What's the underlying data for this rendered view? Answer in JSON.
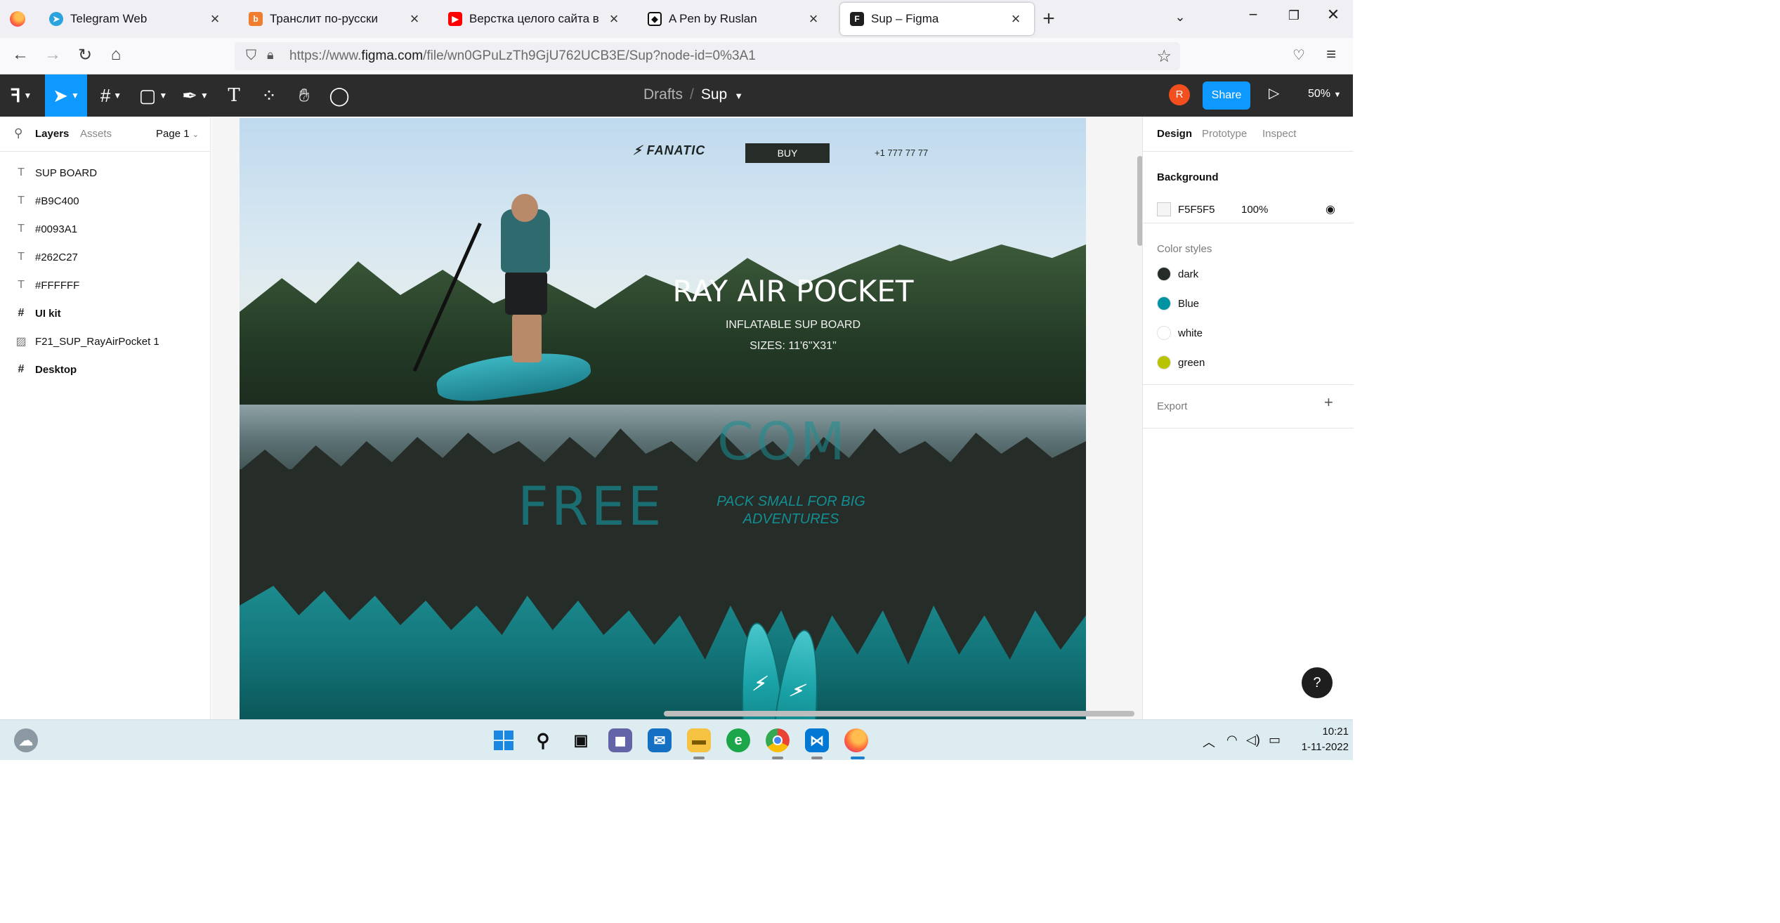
{
  "browser": {
    "tabs": [
      {
        "title": "Telegram Web",
        "favicon": "telegram-icon",
        "color": "#2aa3df"
      },
      {
        "title": "Транслит по-русски",
        "favicon": "translit-icon",
        "color": "#f07c2e"
      },
      {
        "title": "Верстка целого сайта в одном",
        "favicon": "youtube-icon",
        "color": "#ff0000"
      },
      {
        "title": "A Pen by Ruslan",
        "favicon": "codepen-icon",
        "color": "#111111"
      },
      {
        "title": "Sup – Figma",
        "favicon": "figma-icon",
        "color": "#1e1e1e",
        "active": true
      }
    ],
    "url_prefix": "https://www.",
    "url_domain": "figma.com",
    "url_path": "/file/wn0GPuLzTh9GjU762UCB3E/Sup?node-id=0%3A1"
  },
  "figma": {
    "breadcrumb_drafts": "Drafts",
    "breadcrumb_sep": "/",
    "file_name": "Sup",
    "avatar_initial": "R",
    "share_label": "Share",
    "zoom": "50%",
    "left_tabs": {
      "layers": "Layers",
      "assets": "Assets",
      "page": "Page 1"
    },
    "layers": [
      {
        "name": "SUP BOARD",
        "icon": "text-icon",
        "glyph": "T",
        "frame": false
      },
      {
        "name": "#B9C400",
        "icon": "text-icon",
        "glyph": "T",
        "frame": false
      },
      {
        "name": "#0093A1",
        "icon": "text-icon",
        "glyph": "T",
        "frame": false
      },
      {
        "name": "#262C27",
        "icon": "text-icon",
        "glyph": "T",
        "frame": false
      },
      {
        "name": "#FFFFFF",
        "icon": "text-icon",
        "glyph": "T",
        "frame": false
      },
      {
        "name": "UI kit",
        "icon": "frame-icon",
        "glyph": "#",
        "frame": true
      },
      {
        "name": "F21_SUP_RayAirPocket 1",
        "icon": "image-icon",
        "glyph": "▨",
        "frame": false
      },
      {
        "name": "Desktop",
        "icon": "frame-icon",
        "glyph": "#",
        "frame": true
      }
    ],
    "right_tabs": {
      "design": "Design",
      "prototype": "Prototype",
      "inspect": "Inspect"
    },
    "background_heading": "Background",
    "background_hex": "F5F5F5",
    "background_opacity": "100%",
    "color_styles_heading": "Color styles",
    "color_styles": [
      {
        "name": "dark",
        "color": "#262C27"
      },
      {
        "name": "Blue",
        "color": "#0093A1"
      },
      {
        "name": "white",
        "color": "#FFFFFF"
      },
      {
        "name": "green",
        "color": "#B9C400"
      }
    ],
    "export_heading": "Export",
    "help_label": "?"
  },
  "artboard": {
    "logo": "FANATIC",
    "buy_label": "BUY",
    "phone": "+1 777 77 77",
    "title": "RAY AIR POCKET",
    "subtitle": "INFLATABLE SUP BOARD",
    "sizes": "SIZES: 11'6\"X31\"",
    "ghost_com": "COM",
    "ghost_free": "FREE",
    "pack_text": "PACK SMALL FOR BIG ADVENTURES"
  },
  "taskbar": {
    "time": "10:21",
    "date": "1-11-2022"
  }
}
